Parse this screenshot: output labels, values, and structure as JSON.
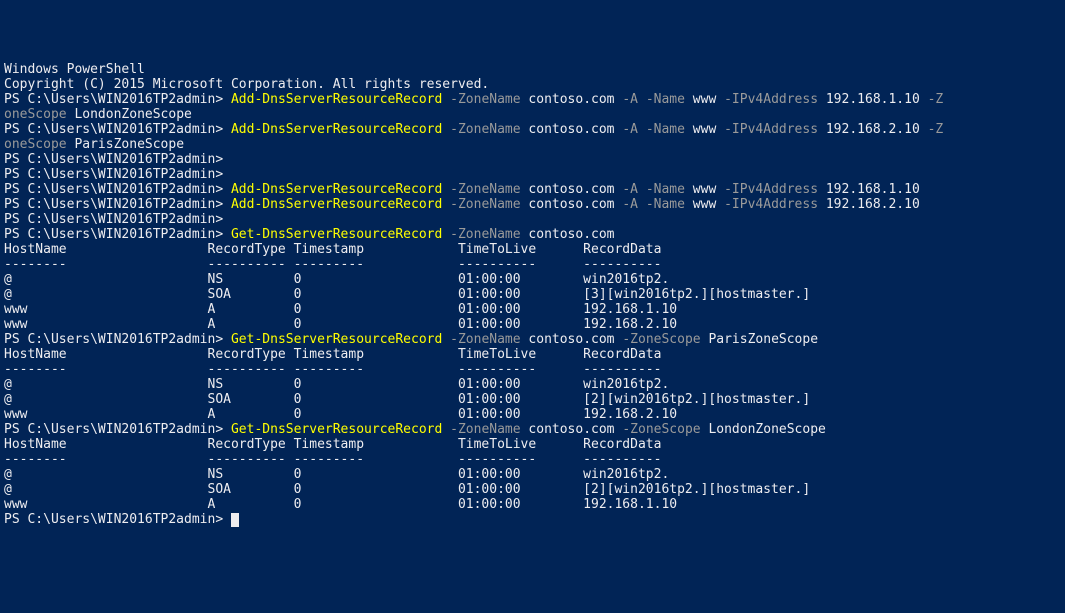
{
  "header": {
    "line1": "Windows PowerShell",
    "line2": "Copyright (C) 2015 Microsoft Corporation. All rights reserved."
  },
  "prompt": "PS C:\\Users\\WIN2016TP2admin>",
  "commands": {
    "add1_a": {
      "cmd": "Add-DnsServerResourceRecord",
      "p1": "-ZoneName",
      "v1": "contoso.com",
      "p2": "-A",
      "p3": "-Name",
      "v3": "www",
      "p4": "-IPv4Address",
      "v4": "192.168.1.10",
      "p5": "-Z"
    },
    "add1_b": {
      "cont": "oneScope",
      "val": "LondonZoneScope"
    },
    "add2_a": {
      "cmd": "Add-DnsServerResourceRecord",
      "p1": "-ZoneName",
      "v1": "contoso.com",
      "p2": "-A",
      "p3": "-Name",
      "v3": "www",
      "p4": "-IPv4Address",
      "v4": "192.168.2.10",
      "p5": "-Z"
    },
    "add2_b": {
      "cont": "oneScope",
      "val": "ParisZoneScope"
    },
    "add3": {
      "cmd": "Add-DnsServerResourceRecord",
      "p1": "-ZoneName",
      "v1": "contoso.com",
      "p2": "-A",
      "p3": "-Name",
      "v3": "www",
      "p4": "-IPv4Address",
      "v4": "192.168.1.10"
    },
    "add4": {
      "cmd": "Add-DnsServerResourceRecord",
      "p1": "-ZoneName",
      "v1": "contoso.com",
      "p2": "-A",
      "p3": "-Name",
      "v3": "www",
      "p4": "-IPv4Address",
      "v4": "192.168.2.10"
    },
    "get1": {
      "cmd": "Get-DnsServerResourceRecord",
      "p1": "-ZoneName",
      "v1": "contoso.com"
    },
    "get2": {
      "cmd": "Get-DnsServerResourceRecord",
      "p1": "-ZoneName",
      "v1": "contoso.com",
      "p2": "-ZoneScope",
      "v2": "ParisZoneScope"
    },
    "get3": {
      "cmd": "Get-DnsServerResourceRecord",
      "p1": "-ZoneName",
      "v1": "contoso.com",
      "p2": "-ZoneScope",
      "v2": "LondonZoneScope"
    }
  },
  "headers": {
    "h": "HostName                  RecordType Timestamp            TimeToLive      RecordData",
    "d": "--------                  ---------- ---------            ----------      ----------"
  },
  "tables": {
    "t1": [
      "@                         NS         0                    01:00:00        win2016tp2.",
      "@                         SOA        0                    01:00:00        [3][win2016tp2.][hostmaster.]",
      "www                       A          0                    01:00:00        192.168.1.10",
      "www                       A          0                    01:00:00        192.168.2.10"
    ],
    "t2": [
      "@                         NS         0                    01:00:00        win2016tp2.",
      "@                         SOA        0                    01:00:00        [2][win2016tp2.][hostmaster.]",
      "www                       A          0                    01:00:00        192.168.2.10"
    ],
    "t3": [
      "@                         NS         0                    01:00:00        win2016tp2.",
      "@                         SOA        0                    01:00:00        [2][win2016tp2.][hostmaster.]",
      "www                       A          0                    01:00:00        192.168.1.10"
    ]
  }
}
